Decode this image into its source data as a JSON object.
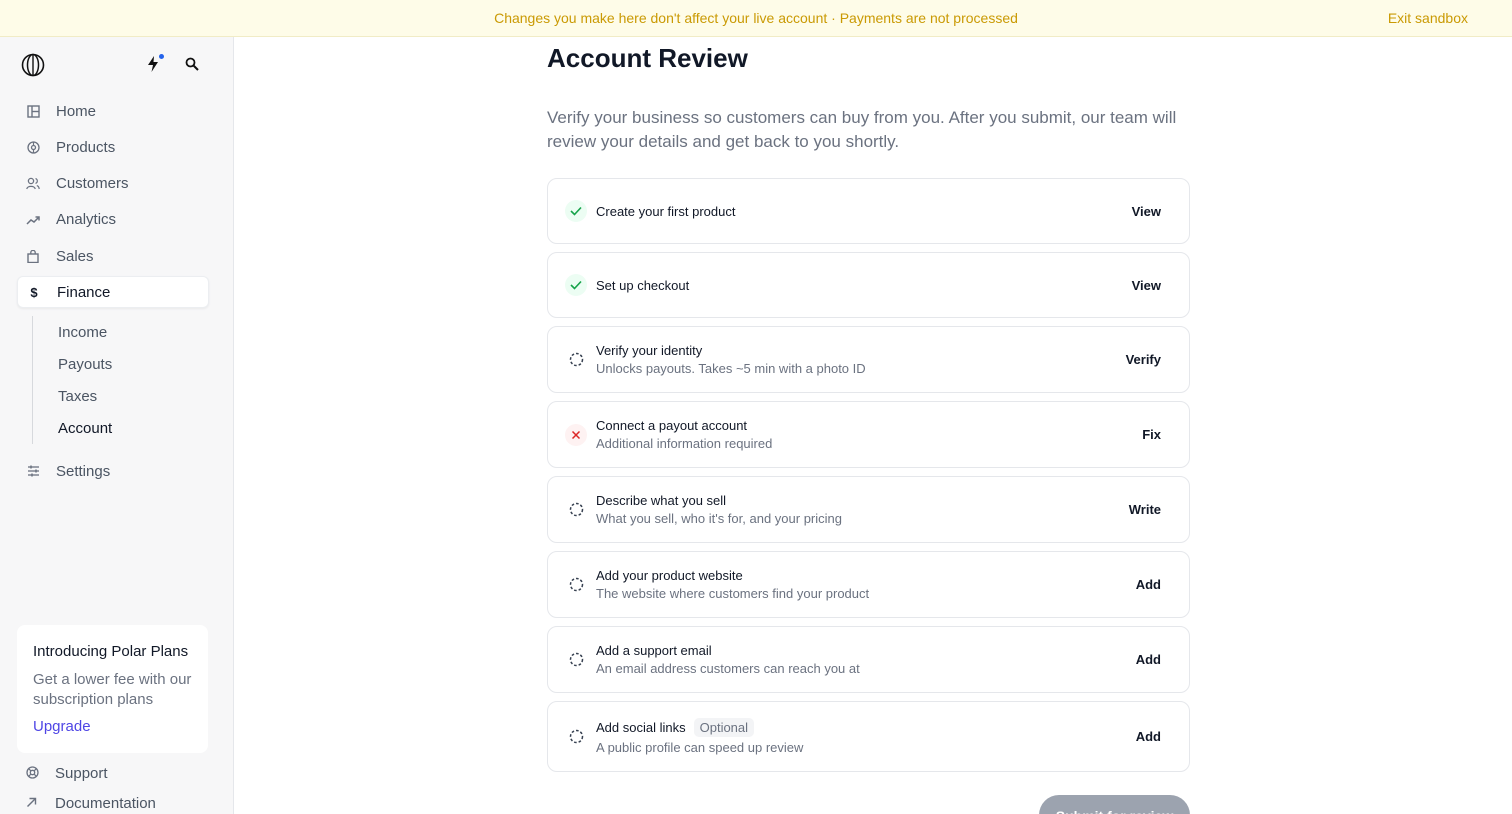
{
  "banner": {
    "message": "Changes you make here don't affect your live account · Payments are not processed",
    "exit_label": "Exit sandbox"
  },
  "sidebar": {
    "nav": [
      {
        "label": "Home",
        "icon": "layout-icon"
      },
      {
        "label": "Products",
        "icon": "products-icon"
      },
      {
        "label": "Customers",
        "icon": "users-icon"
      },
      {
        "label": "Analytics",
        "icon": "trending-up-icon"
      },
      {
        "label": "Sales",
        "icon": "shopping-bag-icon"
      },
      {
        "label": "Finance",
        "icon": "dollar-icon",
        "active": true
      }
    ],
    "finance_sub": [
      {
        "label": "Income"
      },
      {
        "label": "Payouts"
      },
      {
        "label": "Taxes"
      },
      {
        "label": "Account",
        "active": true
      }
    ],
    "settings_label": "Settings",
    "promo": {
      "title": "Introducing Polar Plans",
      "text": "Get a lower fee with our subscription plans",
      "link": "Upgrade"
    },
    "support_label": "Support",
    "documentation_label": "Documentation"
  },
  "main": {
    "title": "Account Review",
    "intro": "Verify your business so customers can buy from you. After you submit, our team will review your details and get back to you shortly.",
    "tasks": [
      {
        "title": "Create your first product",
        "subtitle": "",
        "action": "View",
        "status": "done"
      },
      {
        "title": "Set up checkout",
        "subtitle": "",
        "action": "View",
        "status": "done"
      },
      {
        "title": "Verify your identity",
        "subtitle": "Unlocks payouts. Takes ~5 min with a photo ID",
        "action": "Verify",
        "status": "pending"
      },
      {
        "title": "Connect a payout account",
        "subtitle": "Additional information required",
        "action": "Fix",
        "status": "error"
      },
      {
        "title": "Describe what you sell",
        "subtitle": "What you sell, who it's for, and your pricing",
        "action": "Write",
        "status": "pending"
      },
      {
        "title": "Add your product website",
        "subtitle": "The website where customers find your product",
        "action": "Add",
        "status": "pending"
      },
      {
        "title": "Add a support email",
        "subtitle": "An email address customers can reach you at",
        "action": "Add",
        "status": "pending"
      },
      {
        "title": "Add social links",
        "badge": "Optional",
        "subtitle": "A public profile can speed up review",
        "action": "Add",
        "status": "pending"
      }
    ],
    "submit_label": "Submit for review"
  },
  "colors": {
    "banner_bg": "#fefce8",
    "banner_text": "#ca9a04",
    "success": "#16a34a",
    "error": "#dc2626",
    "link": "#4f46e5"
  }
}
